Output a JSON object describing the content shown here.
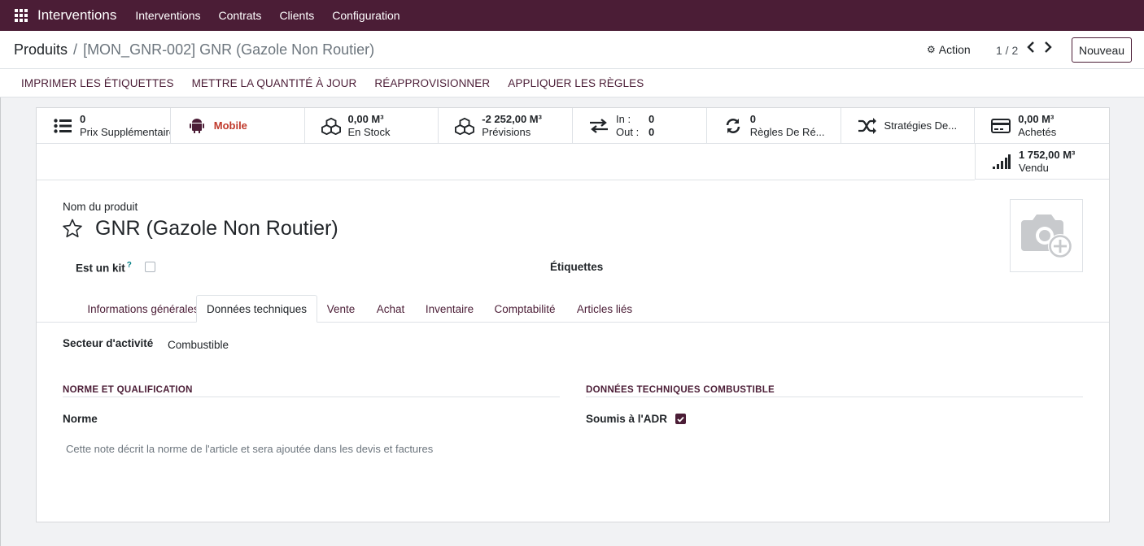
{
  "navbar": {
    "brand": "Interventions",
    "menus": [
      "Interventions",
      "Contrats",
      "Clients",
      "Configuration"
    ]
  },
  "control": {
    "breadcrumb_parent": "Produits",
    "breadcrumb_sep": "/",
    "breadcrumb_current": "[MON_GNR-002] GNR (Gazole Non Routier)",
    "action_label": "Action",
    "pager": "1 / 2",
    "new_label": "Nouveau"
  },
  "statusbar": {
    "buttons": [
      "IMPRIMER LES ÉTIQUETTES",
      "METTRE LA QUANTITÉ À JOUR",
      "RÉAPPROVISIONNER",
      "APPLIQUER LES RÈGLES"
    ]
  },
  "smart_buttons": {
    "extra_prices": {
      "value": "0",
      "label": "Prix Supplémentaires"
    },
    "mobile": {
      "label": "Mobile"
    },
    "stock": {
      "value": "0,00 M³",
      "label": "En Stock"
    },
    "forecast": {
      "value": "-2 252,00 M³",
      "label": "Prévisions"
    },
    "moves": {
      "in_label": "In :",
      "in_value": "0",
      "out_label": "Out :",
      "out_value": "0"
    },
    "rules": {
      "value": "0",
      "label": "Règles De Ré..."
    },
    "strategies": {
      "label": "Stratégies De..."
    },
    "purchased": {
      "value": "0,00 M³",
      "label": "Achetés"
    },
    "sold": {
      "value": "1 752,00 M³",
      "label": "Vendu"
    }
  },
  "form": {
    "name_label": "Nom du produit",
    "name": "GNR (Gazole Non Routier)",
    "kit_label": "Est un kit",
    "kit_help": "?",
    "kit_checked": false,
    "tags_label": "Étiquettes"
  },
  "tabs": [
    "Informations générales",
    "Données techniques",
    "Vente",
    "Achat",
    "Inventaire",
    "Comptabilité",
    "Articles liés"
  ],
  "active_tab": "Données techniques",
  "tech": {
    "sector_label": "Secteur d'activité",
    "sector_value": "Combustible",
    "group1_title": "NORME ET QUALIFICATION",
    "norme_label": "Norme",
    "norme_placeholder": "Cette note décrit la norme de l'article et sera ajoutée dans les devis et factures",
    "group2_title": "DONNÉES TECHNIQUES COMBUSTIBLE",
    "adr_label": "Soumis à l'ADR",
    "adr_checked": true
  },
  "colors": {
    "brand": "#4b1d36",
    "mobile_red": "#c0392b",
    "help_teal": "#017e84"
  }
}
